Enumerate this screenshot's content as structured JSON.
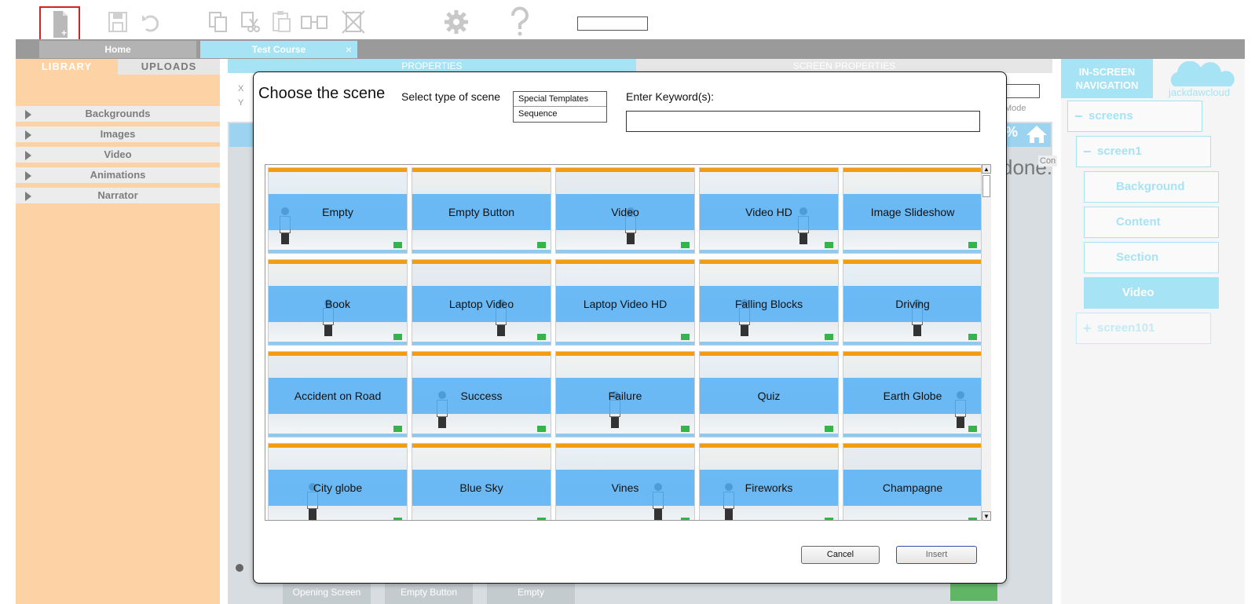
{
  "toolbar": {
    "icons": [
      "new-document-icon",
      "save-icon",
      "undo-icon",
      "copy-icon",
      "cut-icon",
      "paste-icon",
      "duplicate-icon",
      "delete-icon",
      "gear-icon",
      "help-icon"
    ]
  },
  "tabs": {
    "home": "Home",
    "course": "Test Course",
    "close": "×"
  },
  "library": {
    "tabs": [
      "LIBRARY",
      "UPLOADS"
    ],
    "items": [
      "Backgrounds",
      "Images",
      "Video",
      "Animations",
      "Narrator"
    ]
  },
  "center": {
    "properties": "PROPERTIES",
    "screen_properties": "SCREEN PROPERTIES",
    "x_label": "X",
    "y_label": "Y",
    "percent": "%",
    "done_text": "done.",
    "con_text": "Con",
    "preview_mode": "w Mode",
    "thumbnails": [
      "Opening Screen",
      "Empty Button",
      "Empty"
    ]
  },
  "right_nav": {
    "heading_line1": "IN-SCREEN",
    "heading_line2": "NAVIGATION",
    "logo": "jackdawcloud",
    "items": [
      {
        "label": "screens",
        "symbol": "−"
      },
      {
        "label": "screen1",
        "symbol": "−"
      },
      {
        "label": "Background"
      },
      {
        "label": "Content"
      },
      {
        "label": "Section"
      },
      {
        "label": "Video"
      },
      {
        "label": "screen101",
        "symbol": "+"
      }
    ]
  },
  "modal": {
    "title": "Choose the scene",
    "select_label": "Select type of scene",
    "scene_types": [
      "Special Templates",
      "Sequence"
    ],
    "keyword_label": "Enter Keyword(s):",
    "keyword_value": "",
    "scenes": [
      "Empty",
      "Empty Button",
      "Video",
      "Video HD",
      "Image Slideshow",
      "Book",
      "Laptop Video",
      "Laptop Video HD",
      "Falling Blocks",
      "Driving",
      "Accident on Road",
      "Success",
      "Failure",
      "Quiz",
      "Earth Globe",
      "City globe",
      "Blue Sky",
      "Vines",
      "Fireworks",
      "Champagne"
    ],
    "cancel": "Cancel",
    "insert": "Insert",
    "scroll_up": "▲",
    "scroll_down": "▼"
  },
  "colors": {
    "accent": "#a6e3f5",
    "library_bg": "#fdd3a5",
    "tile_band": "#50aff5",
    "highlight_border": "#d32222"
  }
}
